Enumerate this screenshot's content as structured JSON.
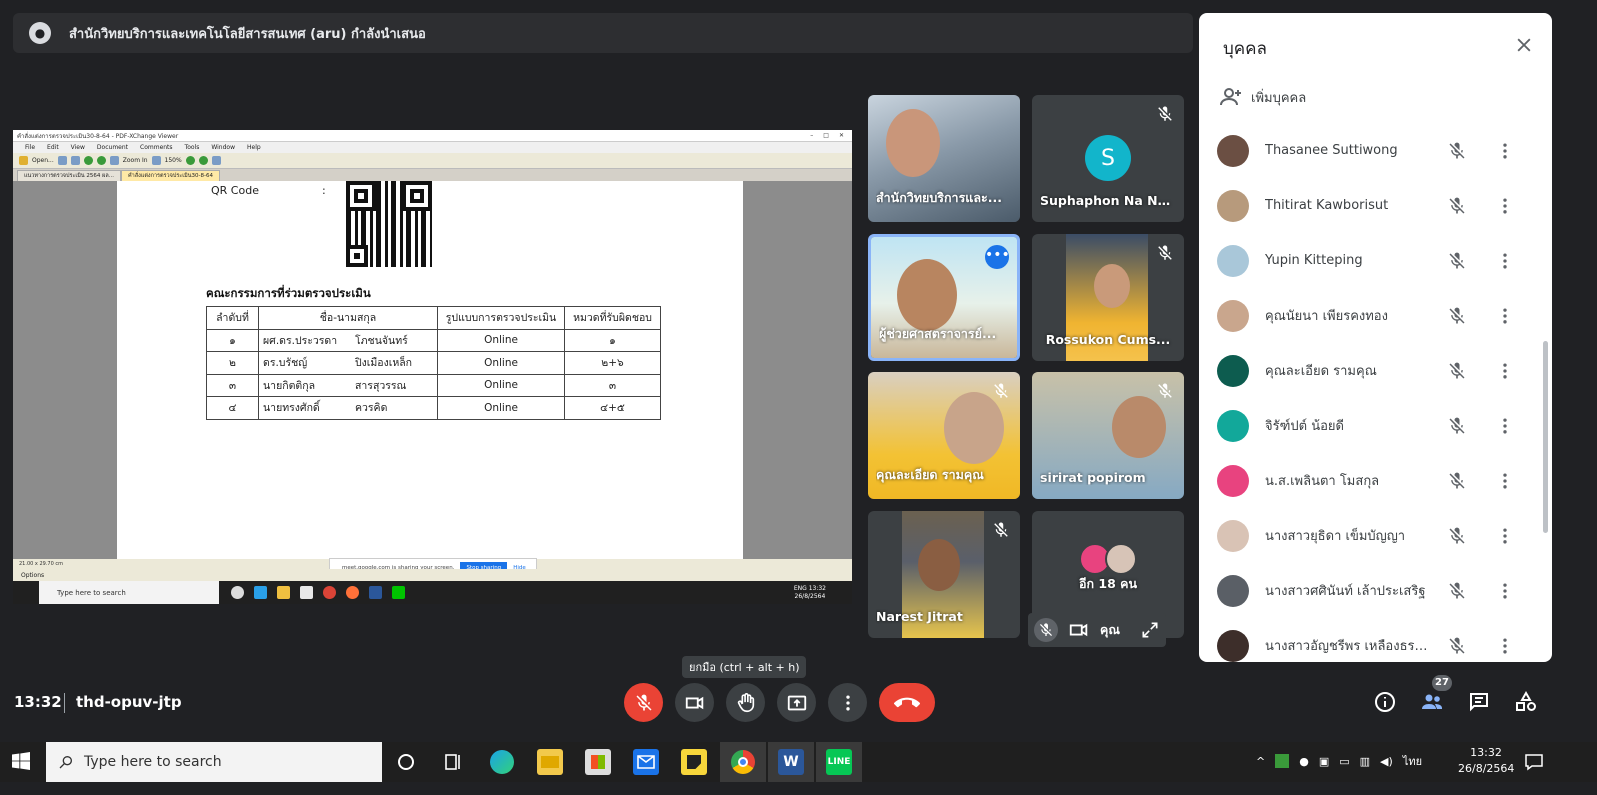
{
  "presenter": {
    "text": "สำนักวิทยบริการและเทคโนโลยีสารสนเทศ (aru) กำลังนำเสนอ"
  },
  "shared_screen": {
    "window_title": "คำสั่งแต่งการตรวจประเมิน30-8-64 - PDF-XChange Viewer",
    "menu": [
      "File",
      "Edit",
      "View",
      "Document",
      "Comments",
      "Tools",
      "Window",
      "Help"
    ],
    "toolbar": {
      "open": "Open...",
      "zoom_label": "Zoom In",
      "zoom_value": "150%"
    },
    "tabs": [
      "แนวทางการตรวจประเมิน 2564 ผล...",
      "คำสั่งแต่งการตรวจประเมิน30-8-64"
    ],
    "doc": {
      "qr_label": "QR Code",
      "qr_colon": ":",
      "committee_title": "คณะกรรมการที่ร่วมตรวจประเมิน",
      "table_headers": [
        "ลำดับที่",
        "ชื่อ-นามสกุล",
        "รูปแบบการตรวจประเมิน",
        "หมวดที่รับผิดชอบ"
      ],
      "rows": [
        {
          "no": "๑",
          "name": "ผศ.ดร.ประวรดา",
          "surname": "โภชนจันทร์",
          "mode": "Online",
          "section": "๑"
        },
        {
          "no": "๒",
          "name": "ดร.บรัชญ์",
          "surname": "ปิงเมืองเหล็ก",
          "mode": "Online",
          "section": "๒+๖"
        },
        {
          "no": "๓",
          "name": "นายกิตติกุล",
          "surname": "สารสุวรรณ",
          "mode": "Online",
          "section": "๓"
        },
        {
          "no": "๔",
          "name": "นายทรงศักดิ์",
          "surname": "ควรคิด",
          "mode": "Online",
          "section": "๔+๕"
        }
      ]
    },
    "status_size": "21.00 x 29.70 cm",
    "share_notice": {
      "text": "meet.google.com is sharing your screen.",
      "stop": "Stop sharing",
      "hide": "Hide"
    },
    "options": "Options",
    "inner_taskbar": {
      "search": "Type here to search",
      "time": "13:32",
      "date": "26/8/2564",
      "lang": "ENG"
    }
  },
  "tiles": [
    {
      "name": "สำนักวิทยบริการและ..."
    },
    {
      "name": "Suphaphon Na No...",
      "initial": "S"
    },
    {
      "name": "ผู้ช่วยศาสตราจารย์..."
    },
    {
      "name": "Rossukon Cums..."
    },
    {
      "name": "คุณละเอียด รามคุณ"
    },
    {
      "name": "sirirat popirom"
    },
    {
      "name": "Narest Jitrat"
    },
    {
      "name": "อีก 18 คน"
    }
  ],
  "self_tile": {
    "label": "คุณ"
  },
  "people_panel": {
    "title": "บุคคล",
    "add": "เพิ่มบุคคล",
    "people": [
      {
        "name": "Thasanee Suttiwong",
        "color": "#6b4f43"
      },
      {
        "name": "Thitirat Kawborisut",
        "color": "#b79a7c"
      },
      {
        "name": "Yupin Kitteping",
        "color": "#a9c7d9"
      },
      {
        "name": "คุณนัยนา เพียรคงทอง",
        "color": "#c9a68d"
      },
      {
        "name": "คุณละเอียด รามคุณ",
        "color": "#0d5c4f"
      },
      {
        "name": "จิรัฑ์ปต์ น้อยดี",
        "color": "#12a89a"
      },
      {
        "name": "น.ส.เพลินตา โมสกุล",
        "color": "#e8437f"
      },
      {
        "name": "นางสาวยุธิดา เข็มบัญญา",
        "color": "#d9c3b5"
      },
      {
        "name": "นางสาวศศินันท์ เล้าประเสริฐ",
        "color": "#5a5f66"
      },
      {
        "name": "นางสาวอัญชรีพร เหลืองธรร...",
        "color": "#3d2e2a"
      }
    ]
  },
  "bottom_bar": {
    "time": "13:32",
    "meeting_code": "thd-opuv-jtp",
    "tooltip": "ยกมือ (ctrl + alt + h)",
    "participant_count": "27"
  },
  "taskbar": {
    "search_placeholder": "Type here to search",
    "lang": "ไทย",
    "time": "13:32",
    "date": "26/8/2564"
  }
}
